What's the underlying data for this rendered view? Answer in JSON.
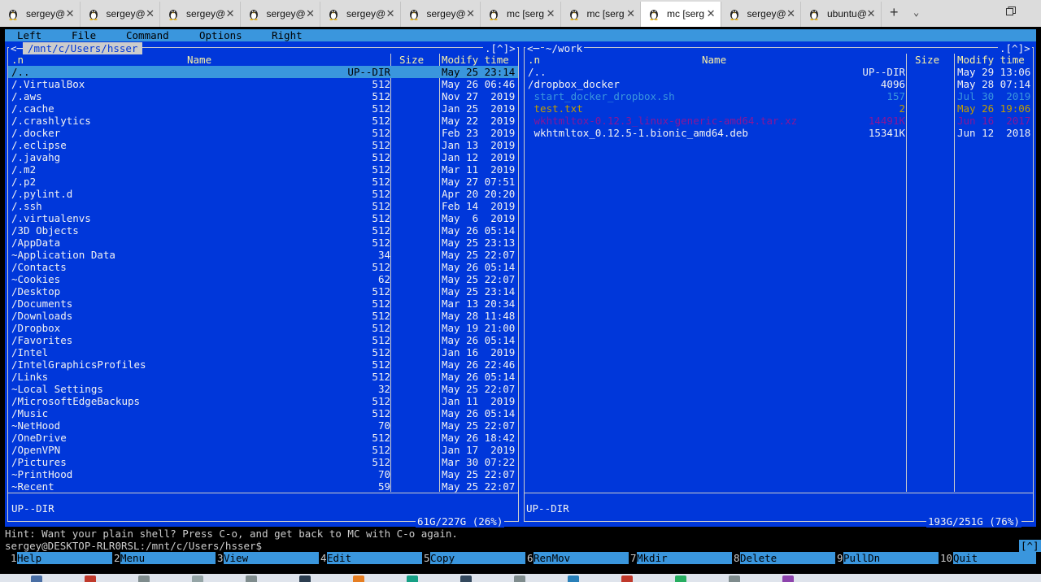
{
  "tabs": [
    {
      "label": "sergey@",
      "active": false
    },
    {
      "label": "sergey@",
      "active": false
    },
    {
      "label": "sergey@",
      "active": false
    },
    {
      "label": "sergey@",
      "active": false
    },
    {
      "label": "sergey@",
      "active": false
    },
    {
      "label": "sergey@",
      "active": false
    },
    {
      "label": "mc [serg",
      "active": false
    },
    {
      "label": "mc [serg",
      "active": false
    },
    {
      "label": "mc [serg",
      "active": true
    },
    {
      "label": "sergey@",
      "active": false
    },
    {
      "label": "ubuntu@",
      "active": false
    }
  ],
  "tab_controls": {
    "new": "+",
    "dropdown": "⌄",
    "close": "✕"
  },
  "menu": [
    "Left",
    "File",
    "Command",
    "Options",
    "Right"
  ],
  "left_panel": {
    "path": "/mnt/c/Users/hsser",
    "history": ".[^]>",
    "corner": "<─",
    "headers": {
      "n": ".n",
      "name": "Name",
      "size": "Size",
      "time": "Modify time"
    },
    "rows": [
      {
        "name": "/..",
        "size": "UP--DIR",
        "time": "May 25 23:14"
      },
      {
        "name": "/.VirtualBox",
        "size": "512",
        "time": "May 26 06:46"
      },
      {
        "name": "/.aws",
        "size": "512",
        "time": "Nov 27  2019"
      },
      {
        "name": "/.cache",
        "size": "512",
        "time": "Jan 25  2019"
      },
      {
        "name": "/.crashlytics",
        "size": "512",
        "time": "May 22  2019"
      },
      {
        "name": "/.docker",
        "size": "512",
        "time": "Feb 23  2019"
      },
      {
        "name": "/.eclipse",
        "size": "512",
        "time": "Jan 13  2019"
      },
      {
        "name": "/.javahg",
        "size": "512",
        "time": "Jan 12  2019"
      },
      {
        "name": "/.m2",
        "size": "512",
        "time": "Mar 11  2019"
      },
      {
        "name": "/.p2",
        "size": "512",
        "time": "May 27 07:51"
      },
      {
        "name": "/.pylint.d",
        "size": "512",
        "time": "Apr 20 20:20"
      },
      {
        "name": "/.ssh",
        "size": "512",
        "time": "Feb 14  2019"
      },
      {
        "name": "/.virtualenvs",
        "size": "512",
        "time": "May  6  2019"
      },
      {
        "name": "/3D Objects",
        "size": "512",
        "time": "May 26 05:14"
      },
      {
        "name": "/AppData",
        "size": "512",
        "time": "May 25 23:13"
      },
      {
        "name": "~Application Data",
        "size": "34",
        "time": "May 25 22:07"
      },
      {
        "name": "/Contacts",
        "size": "512",
        "time": "May 26 05:14"
      },
      {
        "name": "~Cookies",
        "size": "62",
        "time": "May 25 22:07"
      },
      {
        "name": "/Desktop",
        "size": "512",
        "time": "May 25 23:14"
      },
      {
        "name": "/Documents",
        "size": "512",
        "time": "Mar 13 20:34"
      },
      {
        "name": "/Downloads",
        "size": "512",
        "time": "May 28 11:48"
      },
      {
        "name": "/Dropbox",
        "size": "512",
        "time": "May 19 21:00"
      },
      {
        "name": "/Favorites",
        "size": "512",
        "time": "May 26 05:14"
      },
      {
        "name": "/Intel",
        "size": "512",
        "time": "Jan 16  2019"
      },
      {
        "name": "/IntelGraphicsProfiles",
        "size": "512",
        "time": "May 26 22:46"
      },
      {
        "name": "/Links",
        "size": "512",
        "time": "May 26 05:14"
      },
      {
        "name": "~Local Settings",
        "size": "32",
        "time": "May 25 22:07"
      },
      {
        "name": "/MicrosoftEdgeBackups",
        "size": "512",
        "time": "Jan 11  2019"
      },
      {
        "name": "/Music",
        "size": "512",
        "time": "May 26 05:14"
      },
      {
        "name": "~NetHood",
        "size": "70",
        "time": "May 25 22:07"
      },
      {
        "name": "/OneDrive",
        "size": "512",
        "time": "May 26 18:42"
      },
      {
        "name": "/OpenVPN",
        "size": "512",
        "time": "Jan 17  2019"
      },
      {
        "name": "/Pictures",
        "size": "512",
        "time": "Mar 30 07:22"
      },
      {
        "name": "~PrintHood",
        "size": "70",
        "time": "May 25 22:07"
      },
      {
        "name": "~Recent",
        "size": "59",
        "time": "May 25 22:07"
      }
    ],
    "status": "UP--DIR",
    "disk": "61G/227G (26%)"
  },
  "right_panel": {
    "path": "~/work",
    "history": ".[^]>",
    "corner": "<─",
    "headers": {
      "n": ".n",
      "name": "Name",
      "size": "Size",
      "time": "Modify time"
    },
    "rows": [
      {
        "name": "/..",
        "size": "UP--DIR",
        "time": "May 29 13:06",
        "color": "#f2f2f2"
      },
      {
        "name": "/dropbox_docker",
        "size": "4096",
        "time": "May 28 07:14",
        "color": "#f2f2f2"
      },
      {
        "name": " start_docker_dropbox.sh",
        "size": "157",
        "time": "Jul 30  2019",
        "color": "#3a96dd"
      },
      {
        "name": " test.txt",
        "size": "2",
        "time": "May 26 19:06",
        "color": "#c19c00"
      },
      {
        "name": " wkhtmltox-0.12.3_linux-generic-amd64.tar.xz",
        "size": "14491K",
        "time": "Jun 16  2017",
        "color": "#881798"
      },
      {
        "name": " wkhtmltox_0.12.5-1.bionic_amd64.deb",
        "size": "15341K",
        "time": "Jun 12  2018",
        "color": "#f2f2f2"
      }
    ],
    "status": "UP--DIR",
    "disk": "193G/251G (76%)"
  },
  "hint": "Hint: Want your plain shell? Press C-o, and get back to MC with C-o again.",
  "prompt": "sergey@DESKTOP-RLR0RSL:/mnt/c/Users/hsser$",
  "prompt_bracket": "[^]",
  "fkeys": [
    {
      "num": "1",
      "label": "Help"
    },
    {
      "num": "2",
      "label": "Menu"
    },
    {
      "num": "3",
      "label": "View"
    },
    {
      "num": "4",
      "label": "Edit"
    },
    {
      "num": "5",
      "label": "Copy"
    },
    {
      "num": "6",
      "label": "RenMov"
    },
    {
      "num": "7",
      "label": "Mkdir"
    },
    {
      "num": "8",
      "label": "Delete"
    },
    {
      "num": "9",
      "label": "PullDn"
    },
    {
      "num": "10",
      "label": "Quit"
    }
  ],
  "colors": {
    "panel_bg": "#0037da",
    "menu_bg": "#3a96dd",
    "header_fg": "#f9f1a5",
    "frame": "#cccccc",
    "tab_strip": "#dcdcdc"
  },
  "icons": {
    "tab_icon": "tux-penguin-icon",
    "window_control": "restore-window-icon"
  }
}
